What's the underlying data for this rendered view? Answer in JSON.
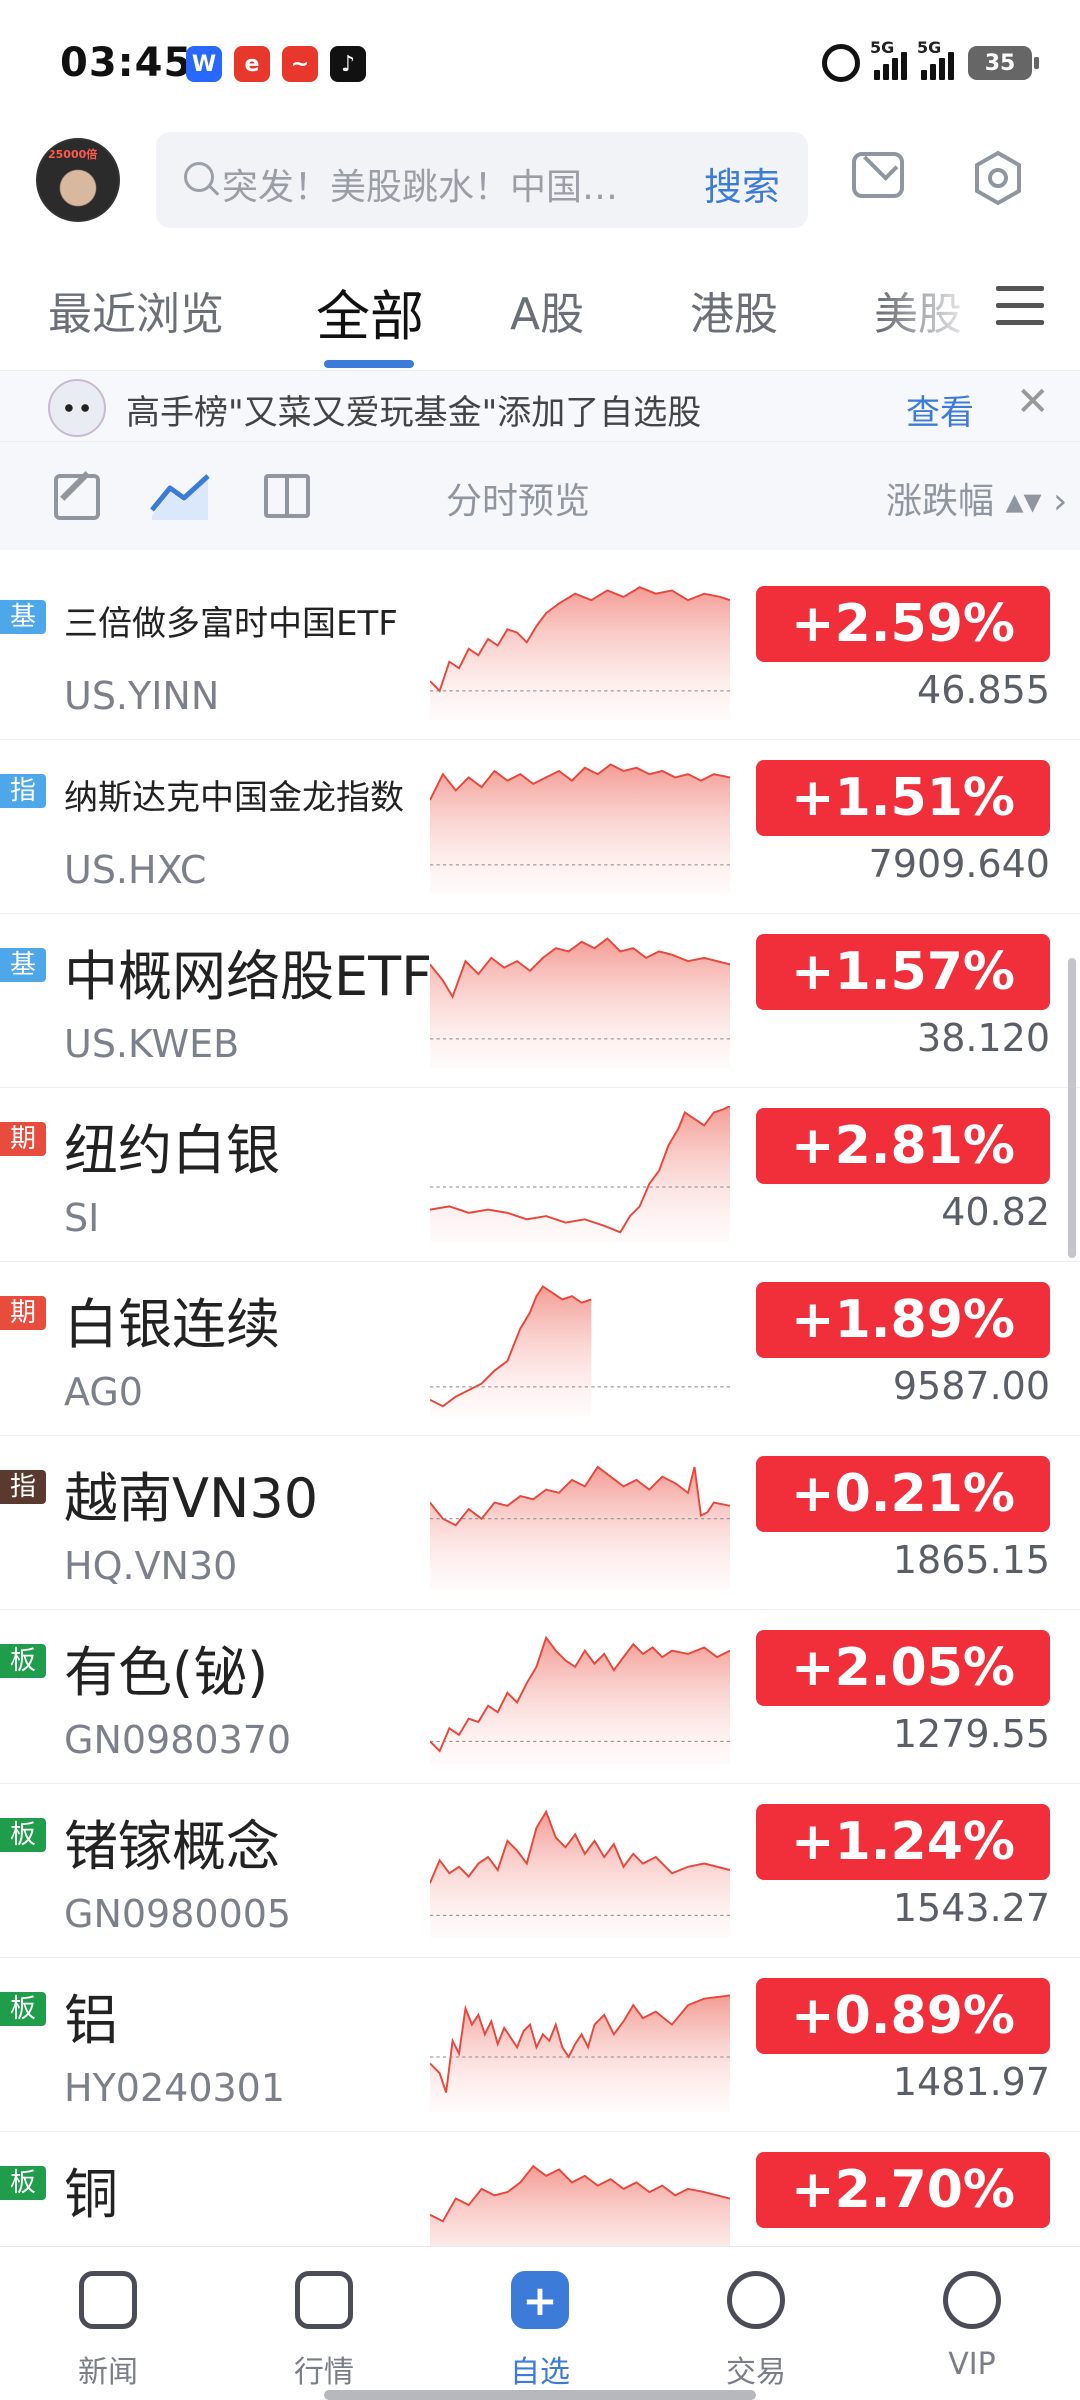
{
  "status_bar": {
    "time": "03:45",
    "apps": [
      {
        "label": "W",
        "color": "#2868ff"
      },
      {
        "label": "e",
        "color": "#e8382b"
      },
      {
        "label": "~",
        "color": "#e8382b"
      },
      {
        "label": "♪",
        "color": "#111111"
      }
    ],
    "signal_labels": [
      "5G",
      "5G"
    ],
    "battery": "35"
  },
  "header": {
    "avatar_badge": "25000倍",
    "search_placeholder": "突发！美股跳水！中国…",
    "search_button": "搜索"
  },
  "tabs": [
    {
      "label": "最近浏览",
      "active": false
    },
    {
      "label": "全部",
      "active": true
    },
    {
      "label": "A股",
      "active": false
    },
    {
      "label": "港股",
      "active": false
    },
    {
      "label": "美股",
      "active": false
    }
  ],
  "notice": {
    "text": "高手榜\"又菜又爱玩基金\"添加了自选股",
    "action": "查看",
    "close": "✕"
  },
  "toolbar": {
    "preview_label": "分时预览",
    "sort_label": "涨跌幅 ▴▾ ›"
  },
  "rows": [
    {
      "tag": "基",
      "tag_color": "#4ea7e8",
      "name": "三倍做多富时中国ETF",
      "small": true,
      "code": "US.YINN",
      "change": "+2.59%",
      "price": "46.855"
    },
    {
      "tag": "指",
      "tag_color": "#4ea7e8",
      "name": "纳斯达克中国金龙指数",
      "small": true,
      "code": "US.HXC",
      "change": "+1.51%",
      "price": "7909.640"
    },
    {
      "tag": "基",
      "tag_color": "#4ea7e8",
      "name": "中概网络股ETF",
      "small": false,
      "code": "US.KWEB",
      "change": "+1.57%",
      "price": "38.120"
    },
    {
      "tag": "期",
      "tag_color": "#e84c3d",
      "name": "纽约白银",
      "small": false,
      "code": "SI",
      "change": "+2.81%",
      "price": "40.82"
    },
    {
      "tag": "期",
      "tag_color": "#e84c3d",
      "name": "白银连续",
      "small": false,
      "code": "AG0",
      "change": "+1.89%",
      "price": "9587.00"
    },
    {
      "tag": "指",
      "tag_color": "#5a3a2e",
      "name": "越南VN30",
      "small": false,
      "code": "HQ.VN30",
      "change": "+0.21%",
      "price": "1865.15"
    },
    {
      "tag": "板",
      "tag_color": "#1f9d4a",
      "name": "有色(铋)",
      "small": false,
      "code": "GN0980370",
      "change": "+2.05%",
      "price": "1279.55"
    },
    {
      "tag": "板",
      "tag_color": "#1f9d4a",
      "name": "锗镓概念",
      "small": false,
      "code": "GN0980005",
      "change": "+1.24%",
      "price": "1543.27"
    },
    {
      "tag": "板",
      "tag_color": "#1f9d4a",
      "name": "铝",
      "small": false,
      "code": "HY0240301",
      "change": "+0.89%",
      "price": "1481.97"
    },
    {
      "tag": "板",
      "tag_color": "#1f9d4a",
      "name": "铜",
      "small": false,
      "code": "",
      "change": "+2.70%",
      "price": ""
    }
  ],
  "bottom_nav": [
    {
      "label": "新闻",
      "icon": "news-icon",
      "active": false
    },
    {
      "label": "行情",
      "icon": "market-icon",
      "active": false
    },
    {
      "label": "自选",
      "icon": "watchlist-plus-icon",
      "active": true
    },
    {
      "label": "交易",
      "icon": "trade-icon",
      "active": false
    },
    {
      "label": "VIP",
      "icon": "vip-icon",
      "active": false
    }
  ]
}
